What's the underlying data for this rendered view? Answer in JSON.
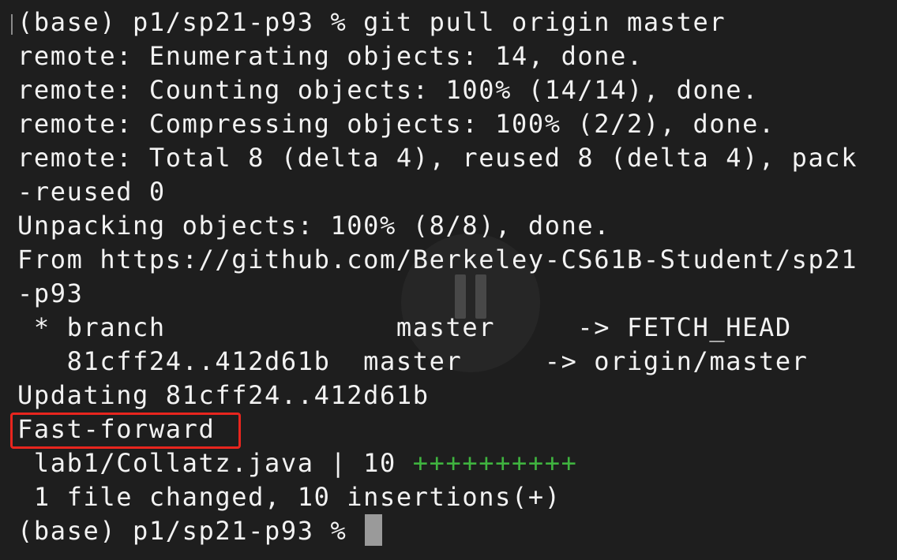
{
  "terminal": {
    "lines": [
      "(base) p1/sp21-p93 % git pull origin master",
      "remote: Enumerating objects: 14, done.",
      "remote: Counting objects: 100% (14/14), done.",
      "remote: Compressing objects: 100% (2/2), done.",
      "remote: Total 8 (delta 4), reused 8 (delta 4), pack",
      "-reused 0",
      "Unpacking objects: 100% (8/8), done.",
      "From https://github.com/Berkeley-CS61B-Student/sp21",
      "-p93",
      " * branch              master     -> FETCH_HEAD",
      "   81cff24..412d61b  master     -> origin/master",
      "Updating 81cff24..412d61b",
      "Fast-forward"
    ],
    "diffstat": {
      "prefix": " lab1/Collatz.java | 10 ",
      "plus": "++++++++++"
    },
    "summary": " 1 file changed, 10 insertions(+)",
    "prompt": "(base) p1/sp21-p93 % "
  },
  "colors": {
    "background": "#1e1e1e",
    "text": "#f2f2f2",
    "diff_plus": "#3fb33f",
    "highlight_box": "#e8251e",
    "cursor": "#9a9a9a"
  },
  "icons": {
    "overlay": "pause-icon"
  }
}
